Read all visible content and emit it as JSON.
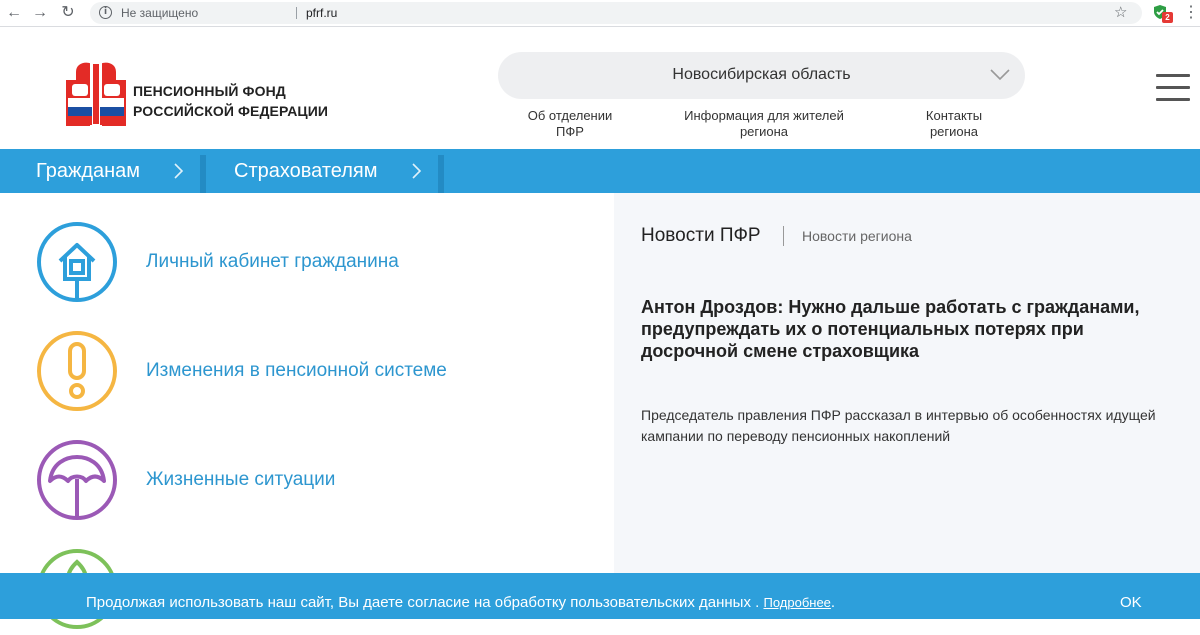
{
  "browser": {
    "security_label": "Не защищено",
    "url": "pfrf.ru",
    "extension_badge": "2"
  },
  "header": {
    "logo_line1": "ПЕНСИОННЫЙ ФОНД",
    "logo_line2": "РОССИЙСКОЙ ФЕДЕРАЦИИ",
    "region": "Новосибирская область",
    "links": [
      {
        "line1": "Об отделении",
        "line2": "ПФР"
      },
      {
        "line1": "Информация для жителей",
        "line2": "региона"
      },
      {
        "line1": "Контакты",
        "line2": "региона"
      }
    ]
  },
  "nav": {
    "items": [
      {
        "label": "Гражданам"
      },
      {
        "label": "Страхователям"
      }
    ]
  },
  "services": [
    {
      "label": "Личный кабинет гражданина",
      "icon": "house-icon",
      "color": "#2d9fdb"
    },
    {
      "label": "Изменения в пенсионной системе",
      "icon": "exclamation-icon",
      "color": "#f5b642"
    },
    {
      "label": "Жизненные ситуации",
      "icon": "umbrella-icon",
      "color": "#9b59b6"
    },
    {
      "label": "",
      "icon": "leaf-icon",
      "color": "#7dc15a"
    }
  ],
  "news": {
    "tab_main": "Новости ПФР",
    "tab_region": "Новости региона",
    "headline": "Антон Дроздов: Нужно дальше работать с гражданами, предупреждать их о потенциальных потерях при досрочной смене страховщика",
    "body": "Председатель правления ПФР рассказал в интервью об особенностях идущей кампании по переводу пенсионных накоплений"
  },
  "cookie": {
    "text": "Продолжая использовать наш сайт, Вы даете согласие на обработку пользовательских данных .",
    "link": "Подробнее",
    "suffix": ".",
    "ok": "OK"
  },
  "colors": {
    "brand_blue": "#2d9fdb",
    "link_blue": "#2d96cf",
    "news_bg": "#f5f7fa"
  }
}
